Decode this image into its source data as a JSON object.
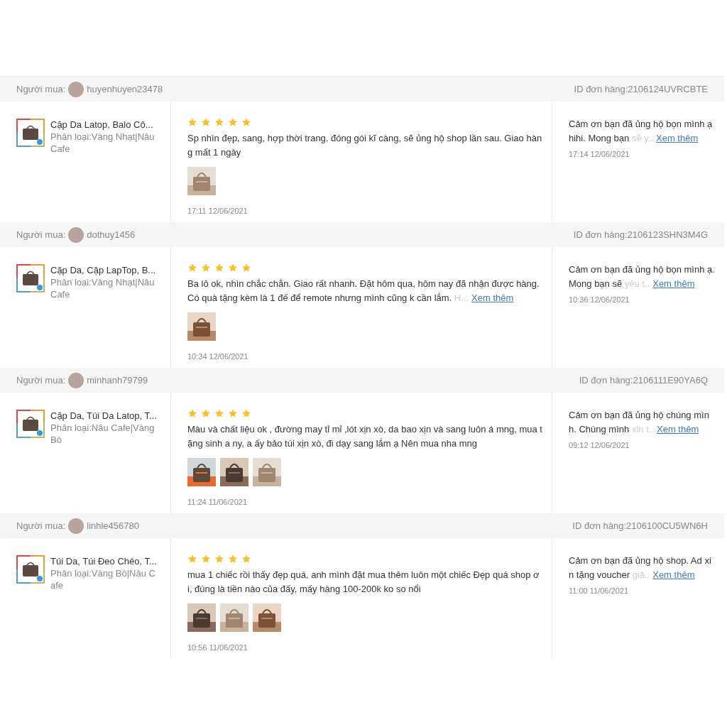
{
  "reviews": [
    {
      "buyer_label": "Người mua:",
      "buyer": "huyenhuyen23478",
      "order_id": "ID đơn hàng:2106124UVRCBTE",
      "product": {
        "name": "Cặp Da Latop, Balo Cô...",
        "variant": "Phân loại:Vàng Nhạt|Nâu Cafe"
      },
      "stars": 5,
      "comment": {
        "text": "Sp nhìn đẹp, sang, hợp thời trang, đóng gói kĩ càng, sẽ ủng hộ shop lần sau. Giao hàng mất 1 ngày"
      },
      "photos": [
        {
          "kind": "picture"
        }
      ],
      "time": "17:11 12/06/2021",
      "reply": {
        "text": "Cảm ơn bạn đã ủng hộ bọn mình ạ hihi. Mong bạn",
        "faded": "sẽ y..",
        "more": "Xem thêm",
        "time": "17:14 12/06/2021"
      }
    },
    {
      "buyer_label": "Người mua:",
      "buyer": "dothuy1456",
      "order_id": "ID đơn hàng:2106123SHN3M4G",
      "product": {
        "name": "Cặp Da, Cặp LapTop, B...",
        "variant": "Phân loại:Vàng Nhạt|Nâu Cafe"
      },
      "stars": 5,
      "comment": {
        "text": "Ba lô ok, nhìn chắc chắn. Giao rất nhanh. Đặt hôm qua, hôm nay đã nhận được hàng. Có quà tặng kèm là 1 đế để remote nhưng mình cũng k cần lắm.",
        "faded": "H...",
        "more": "Xem thêm"
      },
      "photos": [
        {
          "kind": "picture"
        }
      ],
      "time": "10:34 12/06/2021",
      "reply": {
        "text": "Cảm ơn bạn đã ủng hộ bọn mình ạ. Mong bạn sẽ",
        "faded": "yêu t..",
        "more": "Xem thêm",
        "time": "10:36 12/06/2021"
      }
    },
    {
      "buyer_label": "Người mua:",
      "buyer": "minhanh79799",
      "order_id": "ID đơn hàng:2106111E90YA6Q",
      "product": {
        "name": "Cặp Da, Túi Da Latop, T...",
        "variant": "Phân loại:Nâu Cafe|Vàng Bò"
      },
      "stars": 5,
      "comment": {
        "text": "Màu và chất liệu ok , đường may tỉ mỉ ,lót xịn xò, da bao xịn và sang luôn á mng, mua tặng sinh a ny, a ấy bảo túi xịn xò, đi dạy sang lắm ạ Nên mua nha mng"
      },
      "photos": [
        {
          "kind": "picture"
        },
        {
          "kind": "picture"
        },
        {
          "kind": "picture"
        }
      ],
      "time": "11:24 11/06/2021",
      "reply": {
        "text": "Cảm ơn bạn đã ủng hộ chúng mình. Chúng mình",
        "faded": "xin t..",
        "more": "Xem thêm",
        "time": "09:12 12/06/2021"
      }
    },
    {
      "buyer_label": "Người mua:",
      "buyer": "linhle456780",
      "order_id": "ID đơn hàng:2106100CU5WN6H",
      "product": {
        "name": "Túi Da, Túi Đeo Chéo, T...",
        "variant": "Phân loại:Vàng Bò|Nâu Cafe"
      },
      "stars": 5,
      "comment": {
        "text": "mua 1 chiếc rồi thấy đẹp quá, anh mình đặt mua thêm luôn một chiếc Đẹp quá shop ơi, đúng là tiền nào của đấy, mấy hàng 100-200k ko so nổi"
      },
      "photos": [
        {
          "kind": "picture"
        },
        {
          "kind": "picture"
        },
        {
          "kind": "picture"
        }
      ],
      "time": "10:56 11/06/2021",
      "reply": {
        "text": "Cảm ơn bạn đã ủng hộ shop. Ad xin tặng voucher",
        "faded": "giả..",
        "more": "Xem thêm",
        "time": "11:00 11/06/2021"
      }
    }
  ]
}
